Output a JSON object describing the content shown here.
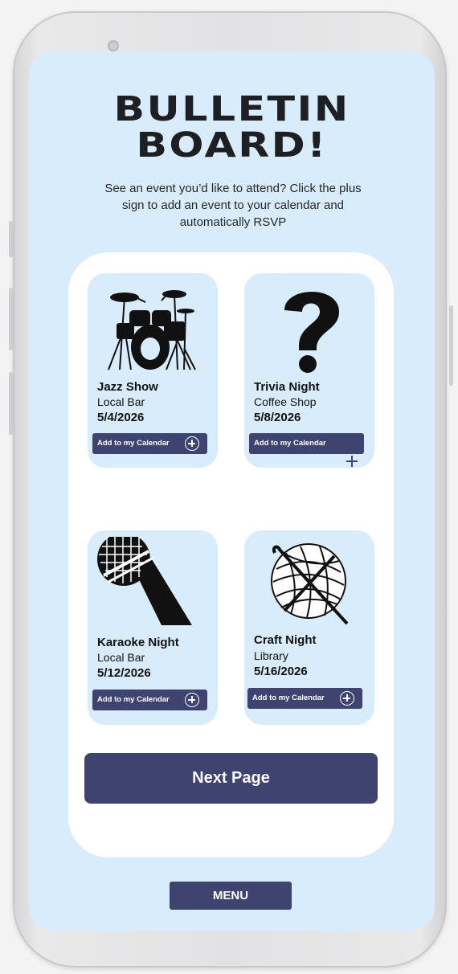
{
  "header": {
    "title_line1": "BULLETIN",
    "title_line2": "BOARD!",
    "subtitle": "See an event you’d like to attend? Click the plus sign to add an event to your calendar and automatically RSVP"
  },
  "events": [
    {
      "name": "Jazz Show",
      "place": "Local Bar",
      "date": "5/4/2026",
      "button_label": "Add to my Calendar",
      "icon": "drum-kit-icon"
    },
    {
      "name": "Trivia Night",
      "place": "Coffee Shop",
      "date": "5/8/2026",
      "button_label": "Add to my Calendar",
      "icon": "question-mark-icon"
    },
    {
      "name": "Karaoke Night",
      "place": "Local Bar",
      "date": "5/12/2026",
      "button_label": "Add to my Calendar",
      "icon": "microphone-icon"
    },
    {
      "name": "Craft Night",
      "place": "Library",
      "date": "5/16/2026",
      "button_label": "Add to my Calendar",
      "icon": "yarn-ball-icon"
    }
  ],
  "next_button": "Next Page",
  "menu_button": "MENU",
  "colors": {
    "screen_bg": "#d8ecfc",
    "accent": "#3f4370",
    "board_bg": "#ffffff"
  }
}
